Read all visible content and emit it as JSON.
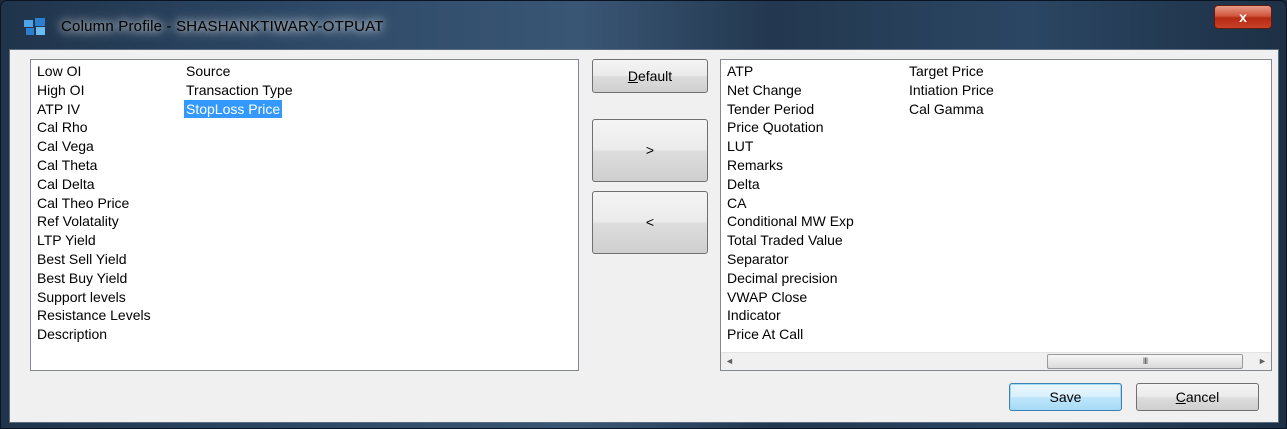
{
  "window": {
    "title": "Column Profile - SHASHANKTIWARY-OTPUAT",
    "close_glyph": "x",
    "app_icon": "grid-app-icon"
  },
  "available_columns": {
    "col1": [
      "Low OI",
      "High OI",
      "ATP IV",
      "Cal Rho",
      "Cal Vega",
      "Cal Theta",
      "Cal Delta",
      "Cal Theo Price",
      "Ref Volatality",
      "LTP Yield",
      "Best Sell Yield",
      "Best Buy Yield",
      "Support levels",
      "Resistance Levels",
      "Description"
    ],
    "col2": [
      "Source",
      "Transaction Type",
      "StopLoss Price"
    ],
    "selected_item": "StopLoss Price"
  },
  "buttons": {
    "default_label_underlined": "D",
    "default_label_rest": "efault",
    "add": ">",
    "remove": "<",
    "save": "Save",
    "cancel_label_underlined": "C",
    "cancel_label_rest": "ancel"
  },
  "displayed_columns": {
    "col1": [
      "ATP",
      "Net Change",
      "Tender Period",
      "Price  Quotation",
      "LUT",
      "Remarks",
      "Delta",
      "CA",
      "Conditional MW Exp",
      "Total Traded Value",
      "Separator",
      "Decimal precision",
      "VWAP Close",
      "Indicator",
      "Price At Call"
    ],
    "col2": [
      "Target Price",
      "Intiation Price",
      "Cal Gamma"
    ]
  },
  "scrollbar": {
    "left_arrow": "◄",
    "right_arrow": "►",
    "thumb_grip": "III"
  }
}
